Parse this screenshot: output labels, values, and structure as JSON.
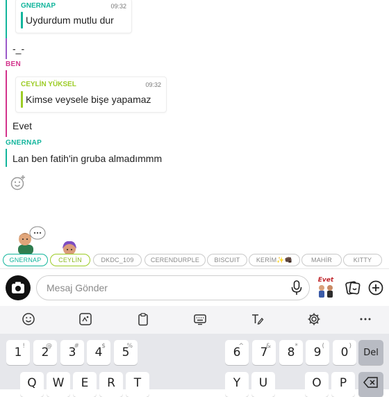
{
  "messages": {
    "q1_name": "GNERNAP",
    "q1_time": "09:32",
    "q1_text": "Uydurdum mutlu dur",
    "m1": "-_-",
    "sender_ben": "BEN",
    "q2_name": "CEYLİN YÜKSEL",
    "q2_time": "09:32",
    "q2_text": "Kimse veysele bişe yapamaz",
    "m2": "Evet",
    "sender_gnernap": "GNERNAP",
    "m3": "Lan ben fatih'in gruba almadımmm"
  },
  "chips": [
    "GNERNAP",
    "CEYLİN",
    "DKDC_109",
    "CERENDURPLE",
    "BISCUIT",
    "KERİM✨👊🏿",
    "MAHİR",
    "KITTY"
  ],
  "input": {
    "placeholder": "Mesaj Gönder"
  },
  "bitmoji_label": "Evet",
  "keyboard": {
    "row1": [
      {
        "main": "1",
        "sub": "!"
      },
      {
        "main": "2",
        "sub": "@"
      },
      {
        "main": "3",
        "sub": "#"
      },
      {
        "main": "4",
        "sub": "$"
      },
      {
        "main": "5",
        "sub": "%"
      },
      {
        "main": "6",
        "sub": "^"
      },
      {
        "main": "7",
        "sub": "&"
      },
      {
        "main": "8",
        "sub": "*"
      },
      {
        "main": "9",
        "sub": "("
      },
      {
        "main": "0",
        "sub": ")"
      }
    ],
    "del": "Del",
    "row2": [
      "Q",
      "W",
      "E",
      "R",
      "T",
      "Y",
      "U",
      "O",
      "P"
    ]
  },
  "colors": {
    "gnernap": "#12b59c",
    "ceylin": "#9ccc25",
    "ben": "#d3338c",
    "accent_dark": "#111111"
  }
}
